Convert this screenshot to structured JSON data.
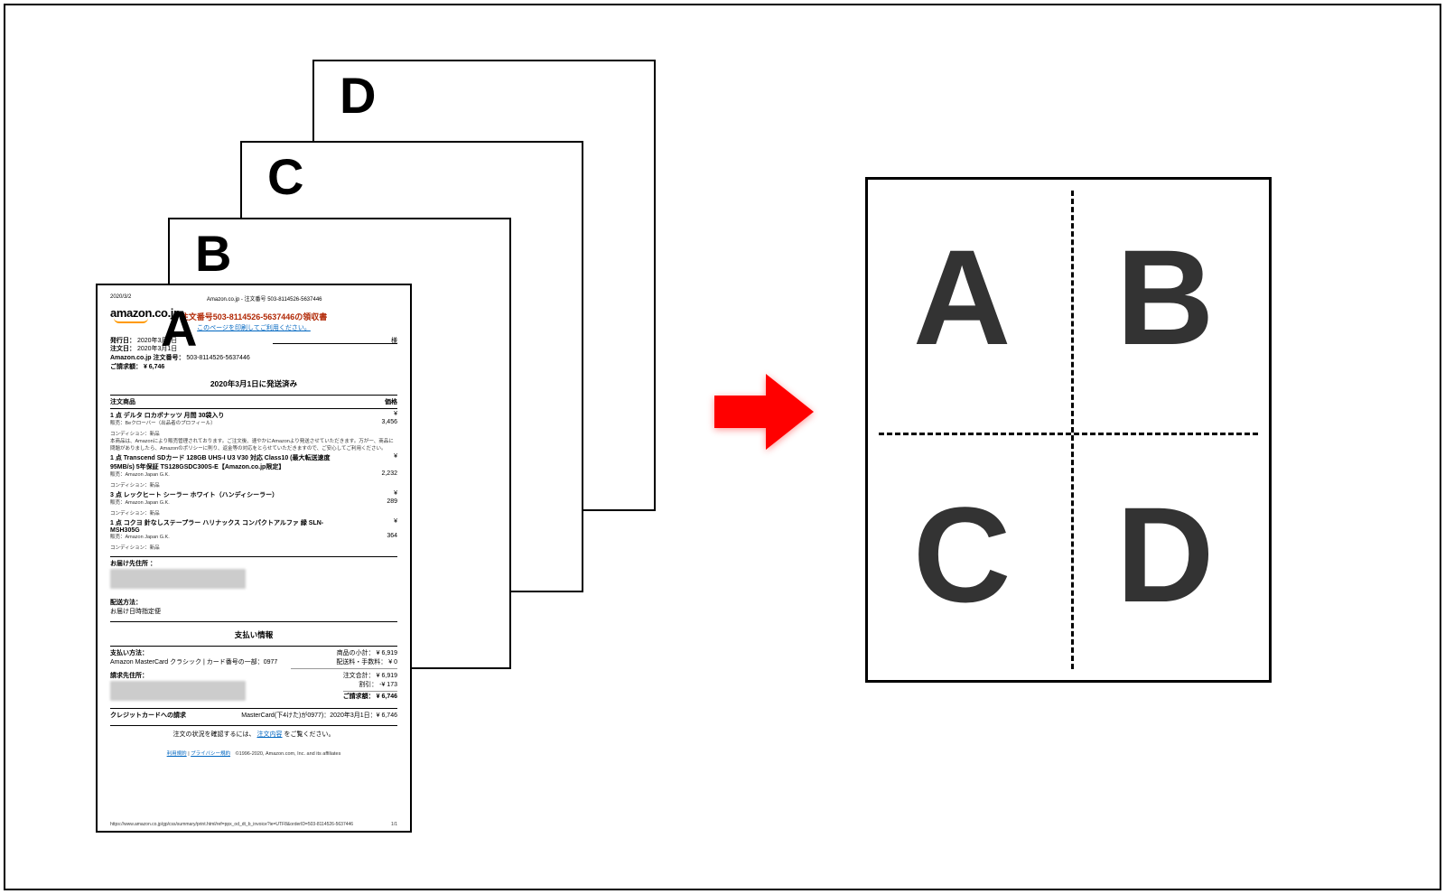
{
  "stack": {
    "labels": {
      "a": "A",
      "b": "B",
      "c": "C",
      "d": "D"
    }
  },
  "combined": {
    "labels": {
      "a": "A",
      "b": "B",
      "c": "C",
      "d": "D"
    }
  },
  "invoice": {
    "tl": "2020/3/2",
    "tc": "Amazon.co.jp - 注文番号 503-8114526-5637446",
    "logo": "amazon.co.jp",
    "title": "注文番号503-8114526-5637446の領収書",
    "subtitle": "このページを印刷してご利用ください。",
    "meta1a": "発行日：",
    "meta1b": "2020年3月2日",
    "meta2a": "注文日：",
    "meta2b": "2020年3月1日",
    "meta3a": "Amazon.co.jp 注文番号：",
    "meta3b": "503-8114526-5637446",
    "meta4a": "ご請求額：",
    "meta4b": "¥ 6,746",
    "sama": "様",
    "shipped": "2020年3月1日に発送済み",
    "col_items": "注文商品",
    "col_price": "価格",
    "item1_name": "1 点  デルタ ロカボナッツ 月間 30袋入り",
    "item1_seller": "販売：Beクローバー（出品者のプロフィール）",
    "item1_price_cur": "¥",
    "item1_price": "3,456",
    "cond_label": "コンディション：新品",
    "note": "本商品は、Amazonにより販売管理されております。ご注文後、速やかにAmazonより発送させていただきます。万が一、商品に問題がありましたら、Amazonのポリシーに則り、返金等の対応をとらせていただきますので、ご安心してご利用ください。",
    "item2_name": "1 点  Transcend SDカード 128GB UHS-I U3 V30 対応 Class10 (最大転送速度95MB/s) 5年保証 TS128GSDC300S-E【Amazon.co.jp限定】",
    "item2_seller": "販売：Amazon Japan G.K.",
    "item2_price_cur": "¥",
    "item2_price": "2,232",
    "item3_name": "3 点  レックヒート シーラー ホワイト（ハンディシーラー）",
    "item3_seller": "販売：Amazon Japan G.K.",
    "item3_price_cur": "¥",
    "item3_price": "289",
    "item4_name": "1 点  コクヨ 針なしステープラー ハリナックス コンパクトアルファ 緑 SLN-MSH305G",
    "item4_seller": "販売：Amazon Japan G.K.",
    "item4_price_cur": "¥",
    "item4_price": "364",
    "shipto_h": "お届け先住所 ：",
    "method_h": "配送方法：",
    "method": "お届け日時指定便",
    "pay_h": "支払い情報",
    "pay_method_h": "支払い方法：",
    "pay_method": "Amazon MasterCard クラシック | カード番号の一部：0977",
    "sub_l": "商品の小計：",
    "sub_r": "¥ 6,919",
    "ship_l": "配送料・手数料：",
    "ship_r": "¥ 0",
    "ordtot_l": "注文合計：",
    "ordtot_r": "¥ 6,919",
    "disc_l": "割引：",
    "disc_r": "-¥ 173",
    "grand_l": "ご請求額：",
    "grand_r": "¥ 6,746",
    "billto_h": "請求先住所：",
    "cc_l": "クレジットカードへの請求",
    "cc_r": "MasterCard(下4けた)が0977)：2020年3月1日：¥ 6,746",
    "check1": "注文の状況を確認するには、",
    "check_link": "注文内容",
    "check2": "をご覧ください。",
    "terms1": "利用規約",
    "terms2": "プライバシー規約",
    "copyright": "©1996-2020, Amazon.com, Inc. and its affiliates",
    "foot_url": "https://www.amazon.co.jp/gp/css/summary/print.html/ref=ppx_od_dt_b_invoice?ie=UTF8&orderID=503-8114526-5637446",
    "foot_pg": "1/1"
  }
}
